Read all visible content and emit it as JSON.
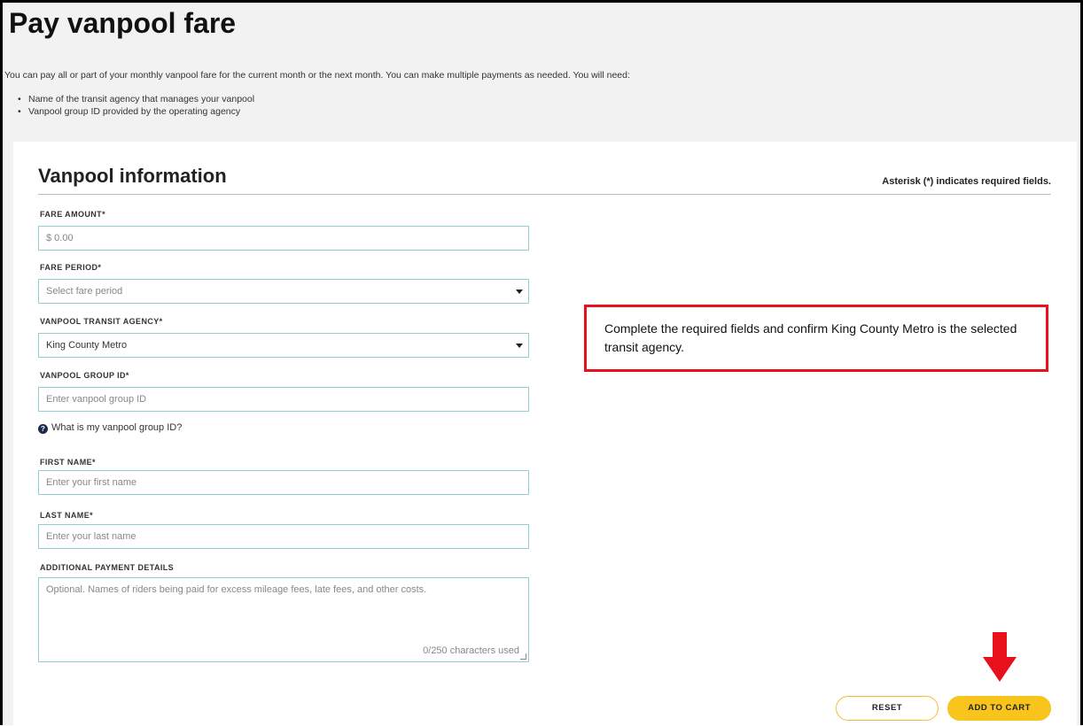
{
  "page": {
    "title": "Pay vanpool fare",
    "intro": "You can pay all or part of your monthly vanpool fare for the current month or the next month. You can make multiple payments as needed. You will need:",
    "needs": [
      "Name of the transit agency that manages your vanpool",
      "Vanpool group ID provided by the operating agency"
    ]
  },
  "form": {
    "title": "Vanpool information",
    "required_note": "Asterisk (*) indicates required fields.",
    "fare_amount": {
      "label": "FARE AMOUNT*",
      "value": "$  0.00"
    },
    "fare_period": {
      "label": "FARE PERIOD*",
      "placeholder": "Select fare period"
    },
    "agency": {
      "label": "VANPOOL TRANSIT AGENCY*",
      "value": "King County Metro"
    },
    "group_id": {
      "label": "VANPOOL GROUP ID*",
      "placeholder": "Enter vanpool group ID"
    },
    "help_link": "What is my vanpool group ID?",
    "first_name": {
      "label": "FIRST NAME*",
      "placeholder": "Enter your first name"
    },
    "last_name": {
      "label": "LAST NAME*",
      "placeholder": "Enter your last name"
    },
    "details": {
      "label": "ADDITIONAL PAYMENT DETAILS",
      "placeholder": "Optional. Names of riders being paid for excess mileage fees, late fees, and other costs.",
      "counter": "0/250 characters used"
    },
    "buttons": {
      "reset": "RESET",
      "add_to_cart": "ADD TO CART"
    }
  },
  "callout": {
    "text": "Complete the required fields and confirm King County Metro is the selected transit agency."
  },
  "colors": {
    "accent": "#f9c41b",
    "field_border": "#8fd0d3",
    "callout_border": "#e8101a"
  }
}
